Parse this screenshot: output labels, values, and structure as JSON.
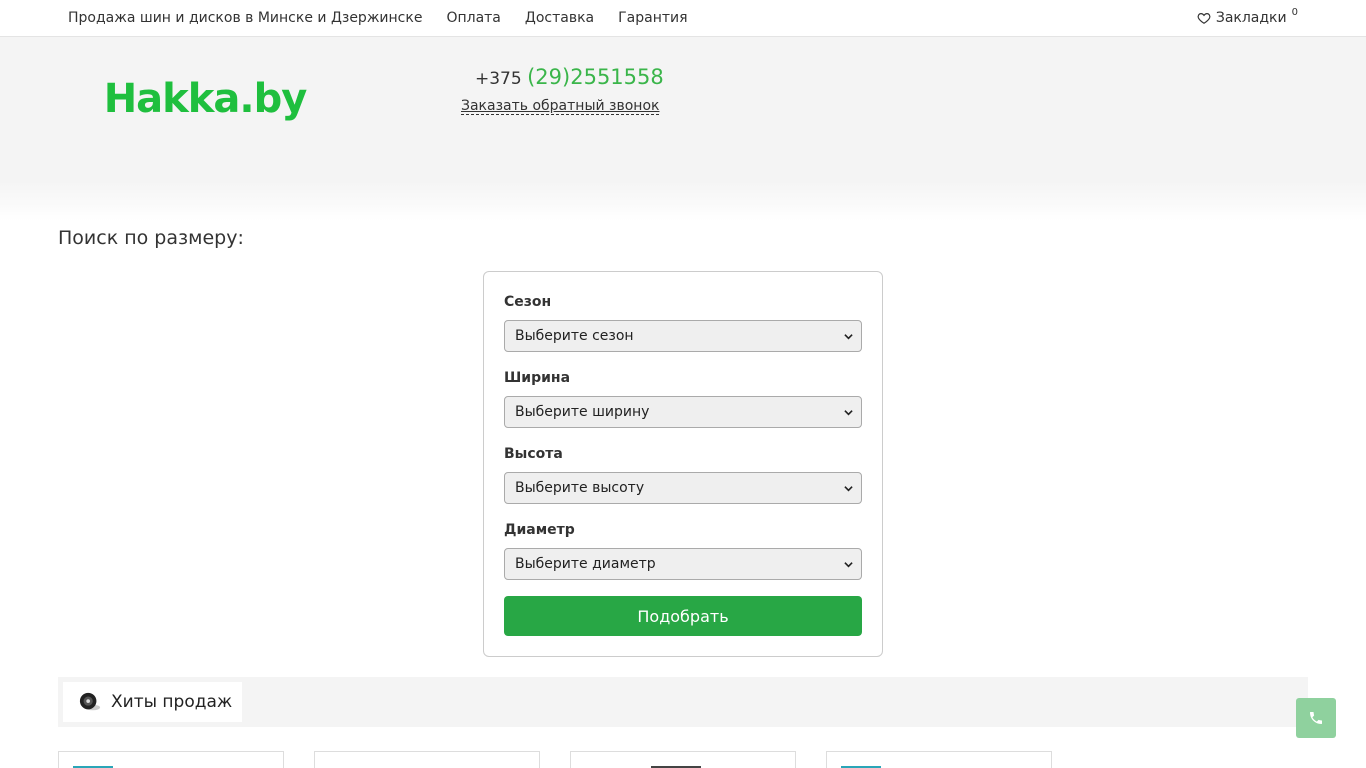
{
  "topnav": {
    "items": [
      {
        "label": "Продажа шин и дисков в Минске и Дзержинске"
      },
      {
        "label": "Оплата"
      },
      {
        "label": "Доставка"
      },
      {
        "label": "Гарантия"
      }
    ],
    "bookmarks_label": "Закладки",
    "bookmarks_count": "0"
  },
  "header": {
    "logo_text": "Hakka.by",
    "phone_prefix": "+375",
    "phone_number": "(29)2551558",
    "callback_label": "Заказать обратный звонок"
  },
  "search": {
    "title": "Поиск по размеру:",
    "fields": [
      {
        "label": "Сезон",
        "value": "Выберите сезон"
      },
      {
        "label": "Ширина",
        "value": "Выберите ширину"
      },
      {
        "label": "Высота",
        "value": "Выберите высоту"
      },
      {
        "label": "Диаметр",
        "value": "Выберите диаметр"
      }
    ],
    "submit_label": "Подобрать"
  },
  "hits": {
    "title": "Хиты продаж"
  },
  "colors": {
    "brand_green": "#1fbf3e",
    "button_green": "#28a745",
    "call_button": "#8fd19e"
  },
  "icons": [
    "heart-icon",
    "chevron-down-icon",
    "tire-icon",
    "phone-icon"
  ]
}
